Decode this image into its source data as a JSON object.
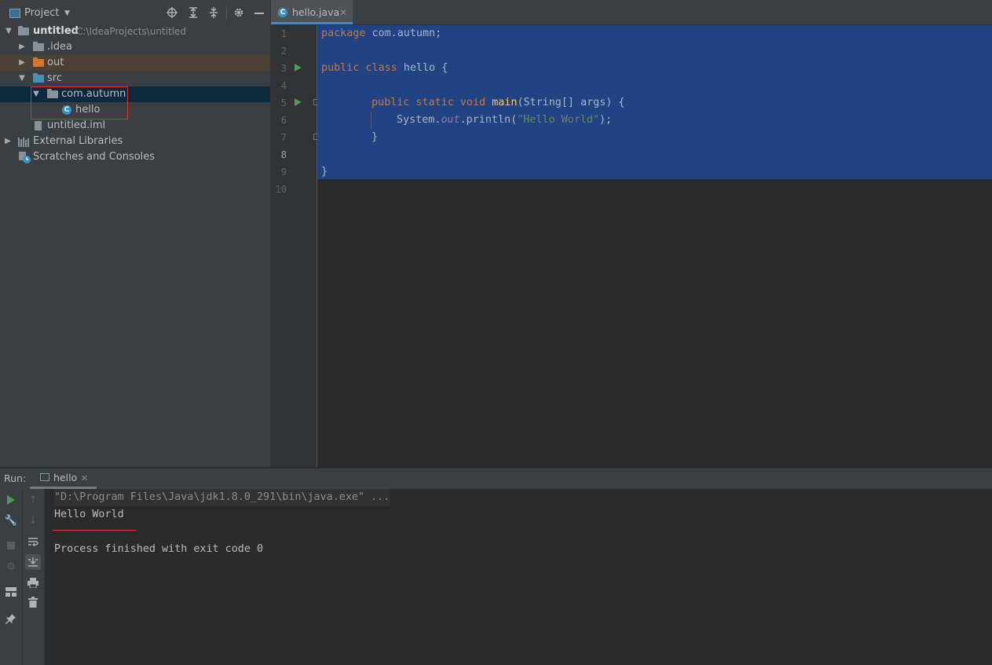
{
  "project_panel": {
    "title": "Project",
    "tree": {
      "root_name": "untitled",
      "root_path": "C:\\IdeaProjects\\untitled",
      "idea": ".idea",
      "out": "out",
      "src": "src",
      "package": "com.autumn",
      "class_hello": "hello",
      "iml": "untitled.iml",
      "external_libraries": "External Libraries",
      "scratches": "Scratches and Consoles"
    }
  },
  "editor": {
    "tab_label": "hello.java",
    "line_numbers": [
      "1",
      "2",
      "3",
      "4",
      "5",
      "6",
      "7",
      "8",
      "9",
      "10"
    ],
    "code": {
      "l1_kw": "package",
      "l1_rest": " com.autumn;",
      "l3_kw": "public class",
      "l3_rest": " hello {",
      "l5_kw": "public static void",
      "l5_fn": "main",
      "l5_rest": "(String[] args) {",
      "l6_a": "System.",
      "l6_out": "out",
      "l6_b": ".println(",
      "l6_str": "\"Hello World\"",
      "l6_c": ");",
      "l7": "}",
      "l9": "}"
    }
  },
  "run_panel": {
    "label": "Run:",
    "tab_label": "hello",
    "console": {
      "command": "\"D:\\Program Files\\Java\\jdk1.8.0_291\\bin\\java.exe\" ...",
      "output": "Hello World",
      "finished": "Process finished with exit code 0"
    }
  },
  "colors": {
    "selection": "#214283",
    "keyword": "#cc7832",
    "function": "#ffc66d",
    "string": "#6a8759",
    "static_field": "#9876aa",
    "highlight_box": "#e03030",
    "run_green": "#499c54"
  }
}
